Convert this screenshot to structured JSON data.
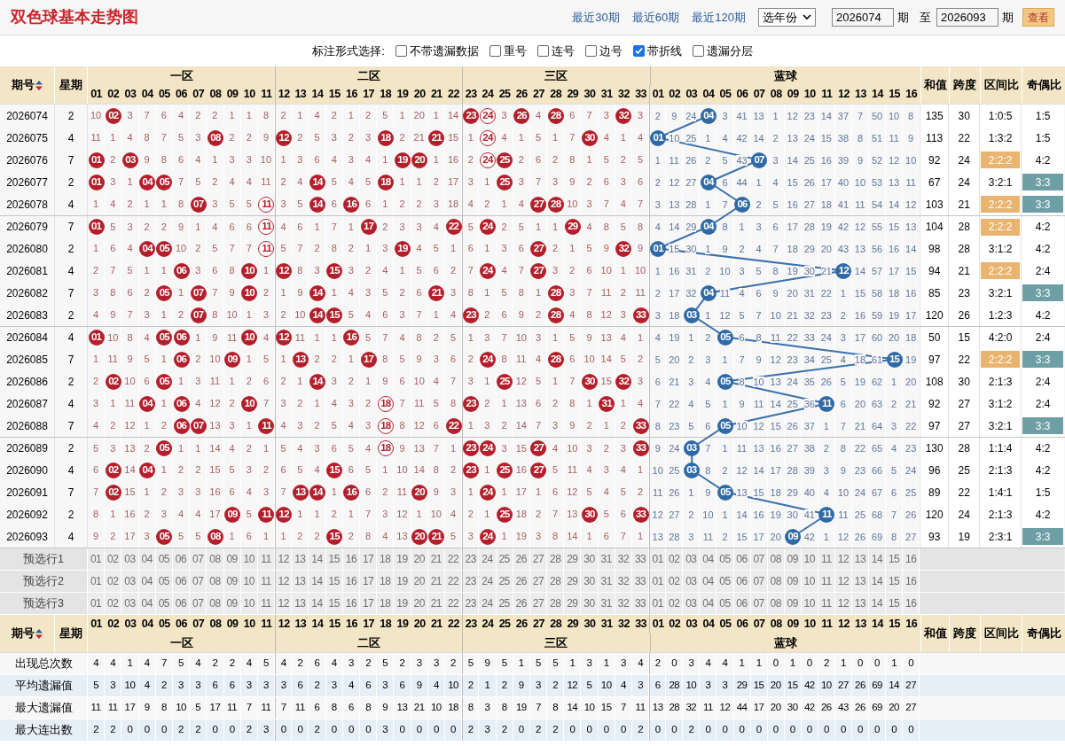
{
  "header": {
    "title": "双色球基本走势图",
    "links": [
      "最近30期",
      "最近60期",
      "最近120期"
    ],
    "year_select": "选年份",
    "from": "2026074",
    "from_unit": "期",
    "to_label": "至",
    "to": "2026093",
    "to_unit": "期",
    "button": "查看"
  },
  "options": {
    "label": "标注形式选择:",
    "items": [
      {
        "label": "不带遗漏数据",
        "checked": false
      },
      {
        "label": "重号",
        "checked": false
      },
      {
        "label": "连号",
        "checked": false
      },
      {
        "label": "边号",
        "checked": false
      },
      {
        "label": "带折线",
        "checked": true
      },
      {
        "label": "遗漏分层",
        "checked": false
      }
    ]
  },
  "top_header": {
    "period": "期号",
    "week": "星期",
    "zones": [
      "一区",
      "二区",
      "三区"
    ],
    "blue_label": "蓝球",
    "red": [
      "01",
      "02",
      "03",
      "04",
      "05",
      "06",
      "07",
      "08",
      "09",
      "10",
      "11",
      "12",
      "13",
      "14",
      "15",
      "16",
      "17",
      "18",
      "19",
      "20",
      "21",
      "22",
      "23",
      "24",
      "25",
      "26",
      "27",
      "28",
      "29",
      "30",
      "31",
      "32",
      "33"
    ],
    "blue": [
      "01",
      "02",
      "03",
      "04",
      "05",
      "06",
      "07",
      "08",
      "09",
      "10",
      "11",
      "12",
      "13",
      "14",
      "15",
      "16"
    ],
    "extra": [
      "和值",
      "跨度",
      "区间比",
      "奇偶比"
    ]
  },
  "rows": [
    {
      "period": "2026074",
      "week": "2",
      "red": [
        "10",
        {
          "v": "02",
          "kind": "hit"
        },
        "3",
        "7",
        "6",
        "4",
        "2",
        "2",
        "1",
        "1",
        "8",
        "2",
        "1",
        "4",
        "2",
        "1",
        "2",
        "5",
        "1",
        "20",
        "1",
        "14",
        {
          "v": "23",
          "kind": "hit"
        },
        {
          "v": "24",
          "kind": "ring"
        },
        "3",
        {
          "v": "26",
          "kind": "hit"
        },
        "4",
        {
          "v": "28",
          "kind": "hit"
        },
        "6",
        "7",
        "3",
        {
          "v": "32",
          "kind": "hit"
        },
        "3"
      ],
      "blue": [
        "2",
        "9",
        "24",
        {
          "v": "04",
          "kind": "hit"
        },
        "3",
        "41",
        "13",
        "1",
        "12",
        "23",
        "14",
        "37",
        "7",
        "50",
        "10",
        "8"
      ],
      "sum": "135",
      "span": "30",
      "zone_ratio": "1:0:5",
      "zone_ratio_marked": false,
      "odd_even": "1:5",
      "odd_even_marked": false
    },
    {
      "period": "2026075",
      "week": "4",
      "red": [
        "11",
        "1",
        "4",
        "8",
        "7",
        "5",
        "3",
        {
          "v": "08",
          "kind": "hit"
        },
        "2",
        "2",
        "9",
        {
          "v": "12",
          "kind": "hit"
        },
        "2",
        "5",
        "3",
        "2",
        "3",
        {
          "v": "18",
          "kind": "hit"
        },
        "2",
        "21",
        {
          "v": "21",
          "kind": "hit"
        },
        "15",
        "1",
        {
          "v": "24",
          "kind": "ring"
        },
        "4",
        "1",
        "5",
        "1",
        "7",
        {
          "v": "30",
          "kind": "hit"
        },
        "4",
        "1",
        "4"
      ],
      "blue": [
        {
          "v": "01",
          "kind": "hit"
        },
        "10",
        "25",
        "1",
        "4",
        "42",
        "14",
        "2",
        "13",
        "24",
        "15",
        "38",
        "8",
        "51",
        "11",
        "9"
      ],
      "sum": "113",
      "span": "22",
      "zone_ratio": "1:3:2",
      "zone_ratio_marked": false,
      "odd_even": "1:5",
      "odd_even_marked": false
    },
    {
      "period": "2026076",
      "week": "7",
      "red": [
        {
          "v": "01",
          "kind": "hit"
        },
        "2",
        {
          "v": "03",
          "kind": "hit"
        },
        "9",
        "8",
        "6",
        "4",
        "1",
        "3",
        "3",
        "10",
        "1",
        "3",
        "6",
        "4",
        "3",
        "4",
        "1",
        {
          "v": "19",
          "kind": "hit"
        },
        {
          "v": "20",
          "kind": "hit"
        },
        "1",
        "16",
        "2",
        {
          "v": "24",
          "kind": "ring"
        },
        {
          "v": "25",
          "kind": "hit"
        },
        "2",
        "6",
        "2",
        "8",
        "1",
        "5",
        "2",
        "5"
      ],
      "blue": [
        "1",
        "11",
        "26",
        "2",
        "5",
        "43",
        {
          "v": "07",
          "kind": "hit"
        },
        "3",
        "14",
        "25",
        "16",
        "39",
        "9",
        "52",
        "12",
        "10"
      ],
      "sum": "92",
      "span": "24",
      "zone_ratio": "2:2:2",
      "zone_ratio_marked": true,
      "odd_even": "4:2",
      "odd_even_marked": false
    },
    {
      "period": "2026077",
      "week": "2",
      "red": [
        {
          "v": "01",
          "kind": "hit"
        },
        "3",
        "1",
        {
          "v": "04",
          "kind": "hit"
        },
        {
          "v": "05",
          "kind": "hit"
        },
        "7",
        "5",
        "2",
        "4",
        "4",
        "11",
        "2",
        "4",
        {
          "v": "14",
          "kind": "hit"
        },
        "5",
        "4",
        "5",
        {
          "v": "18",
          "kind": "hit"
        },
        "1",
        "1",
        "2",
        "17",
        "3",
        "1",
        {
          "v": "25",
          "kind": "hit"
        },
        "3",
        "7",
        "3",
        "9",
        "2",
        "6",
        "3",
        "6"
      ],
      "blue": [
        "2",
        "12",
        "27",
        {
          "v": "04",
          "kind": "hit"
        },
        "6",
        "44",
        "1",
        "4",
        "15",
        "26",
        "17",
        "40",
        "10",
        "53",
        "13",
        "11"
      ],
      "sum": "67",
      "span": "24",
      "zone_ratio": "3:2:1",
      "zone_ratio_marked": false,
      "odd_even": "3:3",
      "odd_even_marked": true
    },
    {
      "period": "2026078",
      "week": "4",
      "red": [
        "1",
        "4",
        "2",
        "1",
        "1",
        "8",
        {
          "v": "07",
          "kind": "hit"
        },
        "3",
        "5",
        "5",
        {
          "v": "11",
          "kind": "ring"
        },
        "3",
        "5",
        {
          "v": "14",
          "kind": "hit"
        },
        "6",
        {
          "v": "16",
          "kind": "hit"
        },
        "6",
        "1",
        "2",
        "2",
        "3",
        "18",
        "4",
        "2",
        "1",
        "4",
        {
          "v": "27",
          "kind": "hit"
        },
        {
          "v": "28",
          "kind": "hit"
        },
        "10",
        "3",
        "7",
        "4",
        "7"
      ],
      "blue": [
        "3",
        "13",
        "28",
        "1",
        "7",
        {
          "v": "06",
          "kind": "hit"
        },
        "2",
        "5",
        "16",
        "27",
        "18",
        "41",
        "11",
        "54",
        "14",
        "12"
      ],
      "sum": "103",
      "span": "21",
      "zone_ratio": "2:2:2",
      "zone_ratio_marked": true,
      "odd_even": "3:3",
      "odd_even_marked": true
    },
    {
      "period": "2026079",
      "week": "7",
      "red": [
        {
          "v": "01",
          "kind": "hit"
        },
        "5",
        "3",
        "2",
        "2",
        "9",
        "1",
        "4",
        "6",
        "6",
        {
          "v": "11",
          "kind": "ring"
        },
        "4",
        "6",
        "1",
        "7",
        "1",
        {
          "v": "17",
          "kind": "hit"
        },
        "2",
        "3",
        "3",
        "4",
        {
          "v": "22",
          "kind": "hit"
        },
        "5",
        {
          "v": "24",
          "kind": "hit"
        },
        "2",
        "5",
        "1",
        "1",
        {
          "v": "29",
          "kind": "hit"
        },
        "4",
        "8",
        "5",
        "8"
      ],
      "blue": [
        "4",
        "14",
        "29",
        {
          "v": "04",
          "kind": "hit"
        },
        "8",
        "1",
        "3",
        "6",
        "17",
        "28",
        "19",
        "42",
        "12",
        "55",
        "15",
        "13"
      ],
      "sum": "104",
      "span": "28",
      "zone_ratio": "2:2:2",
      "zone_ratio_marked": true,
      "odd_even": "4:2",
      "odd_even_marked": false
    },
    {
      "period": "2026080",
      "week": "2",
      "red": [
        "1",
        "6",
        "4",
        {
          "v": "04",
          "kind": "hit"
        },
        {
          "v": "05",
          "kind": "hit"
        },
        "10",
        "2",
        "5",
        "7",
        "7",
        {
          "v": "11",
          "kind": "ring"
        },
        "5",
        "7",
        "2",
        "8",
        "2",
        "1",
        "3",
        {
          "v": "19",
          "kind": "hit"
        },
        "4",
        "5",
        "1",
        "6",
        "1",
        "3",
        "6",
        {
          "v": "27",
          "kind": "hit"
        },
        "2",
        "1",
        "5",
        "9",
        {
          "v": "32",
          "kind": "hit"
        },
        "9"
      ],
      "blue": [
        {
          "v": "01",
          "kind": "hit"
        },
        "15",
        "30",
        "1",
        "9",
        "2",
        "4",
        "7",
        "18",
        "29",
        "20",
        "43",
        "13",
        "56",
        "16",
        "14"
      ],
      "sum": "98",
      "span": "28",
      "zone_ratio": "3:1:2",
      "zone_ratio_marked": false,
      "odd_even": "4:2",
      "odd_even_marked": false
    },
    {
      "period": "2026081",
      "week": "4",
      "red": [
        "2",
        "7",
        "5",
        "1",
        "1",
        {
          "v": "06",
          "kind": "hit"
        },
        "3",
        "6",
        "8",
        {
          "v": "10",
          "kind": "hit"
        },
        "1",
        {
          "v": "12",
          "kind": "hit"
        },
        "8",
        "3",
        {
          "v": "15",
          "kind": "hit"
        },
        "3",
        "2",
        "4",
        "1",
        "5",
        "6",
        "2",
        "7",
        {
          "v": "24",
          "kind": "hit"
        },
        "4",
        "7",
        {
          "v": "27",
          "kind": "hit"
        },
        "3",
        "2",
        "6",
        "10",
        "1",
        "10"
      ],
      "blue": [
        "1",
        "16",
        "31",
        "2",
        "10",
        "3",
        "5",
        "8",
        "19",
        "30",
        "21",
        {
          "v": "12",
          "kind": "hit"
        },
        "14",
        "57",
        "17",
        "15"
      ],
      "sum": "94",
      "span": "21",
      "zone_ratio": "2:2:2",
      "zone_ratio_marked": true,
      "odd_even": "2:4",
      "odd_even_marked": false
    },
    {
      "period": "2026082",
      "week": "7",
      "red": [
        "3",
        "8",
        "6",
        "2",
        {
          "v": "05",
          "kind": "hit"
        },
        "1",
        {
          "v": "07",
          "kind": "hit"
        },
        "7",
        "9",
        {
          "v": "10",
          "kind": "hit"
        },
        "2",
        "1",
        "9",
        {
          "v": "14",
          "kind": "hit"
        },
        "1",
        "4",
        "3",
        "5",
        "2",
        "6",
        {
          "v": "21",
          "kind": "hit"
        },
        "3",
        "8",
        "1",
        "5",
        "8",
        "1",
        {
          "v": "28",
          "kind": "hit"
        },
        "3",
        "7",
        "11",
        "2",
        "11"
      ],
      "blue": [
        "2",
        "17",
        "32",
        {
          "v": "04",
          "kind": "hit"
        },
        "11",
        "4",
        "6",
        "9",
        "20",
        "31",
        "22",
        "1",
        "15",
        "58",
        "18",
        "16"
      ],
      "sum": "85",
      "span": "23",
      "zone_ratio": "3:2:1",
      "zone_ratio_marked": false,
      "odd_even": "3:3",
      "odd_even_marked": true
    },
    {
      "period": "2026083",
      "week": "2",
      "red": [
        "4",
        "9",
        "7",
        "3",
        "1",
        "2",
        {
          "v": "07",
          "kind": "hit"
        },
        "8",
        "10",
        "1",
        "3",
        "2",
        "10",
        {
          "v": "14",
          "kind": "hit"
        },
        {
          "v": "15",
          "kind": "hit"
        },
        "5",
        "4",
        "6",
        "3",
        "7",
        "1",
        "4",
        {
          "v": "23",
          "kind": "hit"
        },
        "2",
        "6",
        "9",
        "2",
        {
          "v": "28",
          "kind": "hit"
        },
        "4",
        "8",
        "12",
        "3",
        {
          "v": "33",
          "kind": "hit"
        }
      ],
      "blue": [
        "3",
        "18",
        {
          "v": "03",
          "kind": "hit"
        },
        "1",
        "12",
        "5",
        "7",
        "10",
        "21",
        "32",
        "23",
        "2",
        "16",
        "59",
        "19",
        "17"
      ],
      "sum": "120",
      "span": "26",
      "zone_ratio": "1:2:3",
      "zone_ratio_marked": false,
      "odd_even": "4:2",
      "odd_even_marked": false
    },
    {
      "period": "2026084",
      "week": "4",
      "red": [
        {
          "v": "01",
          "kind": "hit"
        },
        "10",
        "8",
        "4",
        {
          "v": "05",
          "kind": "hit"
        },
        {
          "v": "06",
          "kind": "hit"
        },
        "1",
        "9",
        "11",
        {
          "v": "10",
          "kind": "hit"
        },
        "4",
        {
          "v": "12",
          "kind": "hit"
        },
        "11",
        "1",
        "1",
        {
          "v": "16",
          "kind": "hit"
        },
        "5",
        "7",
        "4",
        "8",
        "2",
        "5",
        "1",
        "3",
        "7",
        "10",
        "3",
        "1",
        "5",
        "9",
        "13",
        "4",
        "1"
      ],
      "blue": [
        "4",
        "19",
        "1",
        "2",
        {
          "v": "05",
          "kind": "hit"
        },
        "6",
        "8",
        "11",
        "22",
        "33",
        "24",
        "3",
        "17",
        "60",
        "20",
        "18"
      ],
      "sum": "50",
      "span": "15",
      "zone_ratio": "4:2:0",
      "zone_ratio_marked": false,
      "odd_even": "2:4",
      "odd_even_marked": false
    },
    {
      "period": "2026085",
      "week": "7",
      "red": [
        "1",
        "11",
        "9",
        "5",
        "1",
        {
          "v": "06",
          "kind": "hit"
        },
        "2",
        "10",
        {
          "v": "09",
          "kind": "hit"
        },
        "1",
        "5",
        "1",
        {
          "v": "13",
          "kind": "hit"
        },
        "2",
        "2",
        "1",
        {
          "v": "17",
          "kind": "hit"
        },
        "8",
        "5",
        "9",
        "3",
        "6",
        "2",
        {
          "v": "24",
          "kind": "hit"
        },
        "8",
        "11",
        "4",
        {
          "v": "28",
          "kind": "hit"
        },
        "6",
        "10",
        "14",
        "5",
        "2"
      ],
      "blue": [
        "5",
        "20",
        "2",
        "3",
        "1",
        "7",
        "9",
        "12",
        "23",
        "34",
        "25",
        "4",
        "18",
        "61",
        {
          "v": "15",
          "kind": "hit"
        },
        "19"
      ],
      "sum": "97",
      "span": "22",
      "zone_ratio": "2:2:2",
      "zone_ratio_marked": true,
      "odd_even": "3:3",
      "odd_even_marked": true
    },
    {
      "period": "2026086",
      "week": "2",
      "red": [
        "2",
        {
          "v": "02",
          "kind": "hit"
        },
        "10",
        "6",
        {
          "v": "05",
          "kind": "hit"
        },
        "1",
        "3",
        "11",
        "1",
        "2",
        "6",
        "2",
        "1",
        {
          "v": "14",
          "kind": "hit"
        },
        "3",
        "2",
        "1",
        "9",
        "6",
        "10",
        "4",
        "7",
        "3",
        "1",
        {
          "v": "25",
          "kind": "hit"
        },
        "12",
        "5",
        "1",
        "7",
        {
          "v": "30",
          "kind": "hit"
        },
        "15",
        {
          "v": "32",
          "kind": "hit"
        },
        "3"
      ],
      "blue": [
        "6",
        "21",
        "3",
        "4",
        {
          "v": "05",
          "kind": "hit"
        },
        "8",
        "10",
        "13",
        "24",
        "35",
        "26",
        "5",
        "19",
        "62",
        "1",
        "20"
      ],
      "sum": "108",
      "span": "30",
      "zone_ratio": "2:1:3",
      "zone_ratio_marked": false,
      "odd_even": "2:4",
      "odd_even_marked": false
    },
    {
      "period": "2026087",
      "week": "4",
      "red": [
        "3",
        "1",
        "11",
        {
          "v": "04",
          "kind": "hit"
        },
        "1",
        {
          "v": "06",
          "kind": "hit"
        },
        "4",
        "12",
        "2",
        {
          "v": "10",
          "kind": "hit"
        },
        "7",
        "3",
        "2",
        "1",
        "4",
        "3",
        "2",
        {
          "v": "18",
          "kind": "ring"
        },
        "7",
        "11",
        "5",
        "8",
        {
          "v": "23",
          "kind": "hit"
        },
        "2",
        "1",
        "13",
        "6",
        "2",
        "8",
        "1",
        {
          "v": "31",
          "kind": "hit"
        },
        "1",
        "4"
      ],
      "blue": [
        "7",
        "22",
        "4",
        "5",
        "1",
        "9",
        "11",
        "14",
        "25",
        "36",
        {
          "v": "11",
          "kind": "hit"
        },
        "6",
        "20",
        "63",
        "2",
        "21"
      ],
      "sum": "92",
      "span": "27",
      "zone_ratio": "3:1:2",
      "zone_ratio_marked": false,
      "odd_even": "2:4",
      "odd_even_marked": false
    },
    {
      "period": "2026088",
      "week": "7",
      "red": [
        "4",
        "2",
        "12",
        "1",
        "2",
        {
          "v": "06",
          "kind": "hit"
        },
        {
          "v": "07",
          "kind": "hit"
        },
        "13",
        "3",
        "1",
        {
          "v": "11",
          "kind": "hit"
        },
        "4",
        "3",
        "2",
        "5",
        "4",
        "3",
        {
          "v": "18",
          "kind": "ring"
        },
        "8",
        "12",
        "6",
        {
          "v": "22",
          "kind": "hit"
        },
        "1",
        "3",
        "2",
        "14",
        "7",
        "3",
        "9",
        "2",
        "1",
        "2",
        {
          "v": "33",
          "kind": "hit"
        }
      ],
      "blue": [
        "8",
        "23",
        "5",
        "6",
        {
          "v": "05",
          "kind": "hit"
        },
        "10",
        "12",
        "15",
        "26",
        "37",
        "1",
        "7",
        "21",
        "64",
        "3",
        "22"
      ],
      "sum": "97",
      "span": "27",
      "zone_ratio": "3:2:1",
      "zone_ratio_marked": false,
      "odd_even": "3:3",
      "odd_even_marked": true
    },
    {
      "period": "2026089",
      "week": "2",
      "red": [
        "5",
        "3",
        "13",
        "2",
        {
          "v": "05",
          "kind": "hit"
        },
        "1",
        "1",
        "14",
        "4",
        "2",
        "1",
        "5",
        "4",
        "3",
        "6",
        "5",
        "4",
        {
          "v": "18",
          "kind": "ring"
        },
        "9",
        "13",
        "7",
        "1",
        {
          "v": "23",
          "kind": "hit"
        },
        {
          "v": "24",
          "kind": "hit"
        },
        "3",
        "15",
        {
          "v": "27",
          "kind": "hit"
        },
        "4",
        "10",
        "3",
        "2",
        "3",
        {
          "v": "33",
          "kind": "hit"
        }
      ],
      "blue": [
        "9",
        "24",
        {
          "v": "03",
          "kind": "hit"
        },
        "7",
        "1",
        "11",
        "13",
        "16",
        "27",
        "38",
        "2",
        "8",
        "22",
        "65",
        "4",
        "23"
      ],
      "sum": "130",
      "span": "28",
      "zone_ratio": "1:1:4",
      "zone_ratio_marked": false,
      "odd_even": "4:2",
      "odd_even_marked": false
    },
    {
      "period": "2026090",
      "week": "4",
      "red": [
        "6",
        {
          "v": "02",
          "kind": "hit"
        },
        "14",
        {
          "v": "04",
          "kind": "hit"
        },
        "1",
        "2",
        "2",
        "15",
        "5",
        "3",
        "2",
        "6",
        "5",
        "4",
        {
          "v": "15",
          "kind": "hit"
        },
        "6",
        "5",
        "1",
        "10",
        "14",
        "8",
        "2",
        {
          "v": "23",
          "kind": "hit"
        },
        "1",
        {
          "v": "25",
          "kind": "hit"
        },
        "16",
        {
          "v": "27",
          "kind": "hit"
        },
        "5",
        "11",
        "4",
        "3",
        "4",
        "1"
      ],
      "blue": [
        "10",
        "25",
        {
          "v": "03",
          "kind": "hit"
        },
        "8",
        "2",
        "12",
        "14",
        "17",
        "28",
        "39",
        "3",
        "9",
        "23",
        "66",
        "5",
        "24"
      ],
      "sum": "96",
      "span": "25",
      "zone_ratio": "2:1:3",
      "zone_ratio_marked": false,
      "odd_even": "4:2",
      "odd_even_marked": false
    },
    {
      "period": "2026091",
      "week": "7",
      "red": [
        "7",
        {
          "v": "02",
          "kind": "hit"
        },
        "15",
        "1",
        "2",
        "3",
        "3",
        "16",
        "6",
        "4",
        "3",
        "7",
        {
          "v": "13",
          "kind": "hit"
        },
        {
          "v": "14",
          "kind": "hit"
        },
        "1",
        {
          "v": "16",
          "kind": "hit"
        },
        "6",
        "2",
        "11",
        {
          "v": "20",
          "kind": "hit"
        },
        "9",
        "3",
        "1",
        {
          "v": "24",
          "kind": "hit"
        },
        "1",
        "17",
        "1",
        "6",
        "12",
        "5",
        "4",
        "5",
        "2"
      ],
      "blue": [
        "11",
        "26",
        "1",
        "9",
        {
          "v": "05",
          "kind": "hit"
        },
        "13",
        "15",
        "18",
        "29",
        "40",
        "4",
        "10",
        "24",
        "67",
        "6",
        "25"
      ],
      "sum": "89",
      "span": "22",
      "zone_ratio": "1:4:1",
      "zone_ratio_marked": false,
      "odd_even": "1:5",
      "odd_even_marked": false
    },
    {
      "period": "2026092",
      "week": "2",
      "red": [
        "8",
        "1",
        "16",
        "2",
        "3",
        "4",
        "4",
        "17",
        {
          "v": "09",
          "kind": "hit"
        },
        "5",
        {
          "v": "11",
          "kind": "hit"
        },
        {
          "v": "12",
          "kind": "hit"
        },
        "1",
        "1",
        "2",
        "1",
        "7",
        "3",
        "12",
        "1",
        "10",
        "4",
        "2",
        "1",
        {
          "v": "25",
          "kind": "hit"
        },
        "18",
        "2",
        "7",
        "13",
        {
          "v": "30",
          "kind": "hit"
        },
        "5",
        "6",
        {
          "v": "33",
          "kind": "hit"
        }
      ],
      "blue": [
        "12",
        "27",
        "2",
        "10",
        "1",
        "14",
        "16",
        "19",
        "30",
        "41",
        {
          "v": "11",
          "kind": "hit"
        },
        "11",
        "25",
        "68",
        "7",
        "26"
      ],
      "sum": "120",
      "span": "24",
      "zone_ratio": "2:1:3",
      "zone_ratio_marked": false,
      "odd_even": "4:2",
      "odd_even_marked": false
    },
    {
      "period": "2026093",
      "week": "4",
      "red": [
        "9",
        "2",
        "17",
        "3",
        {
          "v": "05",
          "kind": "hit"
        },
        "5",
        "5",
        {
          "v": "08",
          "kind": "hit"
        },
        "1",
        "6",
        "1",
        "1",
        "2",
        "2",
        {
          "v": "15",
          "kind": "hit"
        },
        "2",
        "8",
        "4",
        "13",
        {
          "v": "20",
          "kind": "hit"
        },
        {
          "v": "21",
          "kind": "hit"
        },
        "5",
        "3",
        {
          "v": "24",
          "kind": "hit"
        },
        "1",
        "19",
        "3",
        "8",
        "14",
        "1",
        "6",
        "7",
        "1"
      ],
      "blue": [
        "13",
        "28",
        "3",
        "11",
        "2",
        "15",
        "17",
        "20",
        {
          "v": "09",
          "kind": "hit"
        },
        "42",
        "1",
        "12",
        "26",
        "69",
        "8",
        "27"
      ],
      "sum": "93",
      "span": "19",
      "zone_ratio": "2:3:1",
      "zone_ratio_marked": false,
      "odd_even": "3:3",
      "odd_even_marked": true
    }
  ],
  "preselect": [
    {
      "label": "预选行1",
      "red": [
        "01",
        "02",
        "03",
        "04",
        "05",
        "06",
        "07",
        "08",
        "09",
        "10",
        "11",
        "12",
        "13",
        "14",
        "15",
        "16",
        "17",
        "18",
        "19",
        "20",
        "21",
        "22",
        "23",
        "24",
        "25",
        "26",
        "27",
        "28",
        "29",
        "30",
        "31",
        "32",
        "33"
      ],
      "blue": [
        "01",
        "02",
        "03",
        "04",
        "05",
        "06",
        "07",
        "08",
        "09",
        "10",
        "11",
        "12",
        "13",
        "14",
        "15",
        "16"
      ]
    },
    {
      "label": "预选行2",
      "red": [
        "01",
        "02",
        "03",
        "04",
        "05",
        "06",
        "07",
        "08",
        "09",
        "10",
        "11",
        "12",
        "13",
        "14",
        "15",
        "16",
        "17",
        "18",
        "19",
        "20",
        "21",
        "22",
        "23",
        "24",
        "25",
        "26",
        "27",
        "28",
        "29",
        "30",
        "31",
        "32",
        "33"
      ],
      "blue": [
        "01",
        "02",
        "03",
        "04",
        "05",
        "06",
        "07",
        "08",
        "09",
        "10",
        "11",
        "12",
        "13",
        "14",
        "15",
        "16"
      ]
    },
    {
      "label": "预选行3",
      "red": [
        "01",
        "02",
        "03",
        "04",
        "05",
        "06",
        "07",
        "08",
        "09",
        "10",
        "11",
        "12",
        "13",
        "14",
        "15",
        "16",
        "17",
        "18",
        "19",
        "20",
        "21",
        "22",
        "23",
        "24",
        "25",
        "26",
        "27",
        "28",
        "29",
        "30",
        "31",
        "32",
        "33"
      ],
      "blue": [
        "01",
        "02",
        "03",
        "04",
        "05",
        "06",
        "07",
        "08",
        "09",
        "10",
        "11",
        "12",
        "13",
        "14",
        "15",
        "16"
      ]
    }
  ],
  "bottom_header": {
    "period": "期号",
    "week": "星期",
    "zones": [
      "一区",
      "二区",
      "三区"
    ],
    "blue_label": "蓝球",
    "red": [
      "01",
      "02",
      "03",
      "04",
      "05",
      "06",
      "07",
      "08",
      "09",
      "10",
      "11",
      "12",
      "13",
      "14",
      "15",
      "16",
      "17",
      "18",
      "19",
      "20",
      "21",
      "22",
      "23",
      "24",
      "25",
      "26",
      "27",
      "28",
      "29",
      "30",
      "31",
      "32",
      "33"
    ],
    "blue": [
      "01",
      "02",
      "03",
      "04",
      "05",
      "06",
      "07",
      "08",
      "09",
      "10",
      "11",
      "12",
      "13",
      "14",
      "15",
      "16"
    ],
    "extra": [
      "和值",
      "跨度",
      "区间比",
      "奇偶比"
    ]
  },
  "stats": [
    {
      "label": "出现总次数",
      "red": [
        "4",
        "4",
        "1",
        "4",
        "7",
        "5",
        "4",
        "2",
        "2",
        "4",
        "5",
        "4",
        "2",
        "6",
        "4",
        "3",
        "2",
        "5",
        "2",
        "3",
        "3",
        "2",
        "5",
        "9",
        "5",
        "1",
        "5",
        "5",
        "1",
        "3",
        "1",
        "3",
        "4"
      ],
      "blue": [
        "2",
        "0",
        "3",
        "4",
        "4",
        "1",
        "1",
        "0",
        "1",
        "0",
        "2",
        "1",
        "0",
        "0",
        "1",
        "0"
      ]
    },
    {
      "label": "平均遗漏值",
      "red": [
        "5",
        "3",
        "10",
        "4",
        "2",
        "3",
        "3",
        "6",
        "6",
        "3",
        "3",
        "3",
        "6",
        "2",
        "3",
        "4",
        "6",
        "3",
        "6",
        "9",
        "4",
        "10",
        "2",
        "1",
        "2",
        "9",
        "3",
        "2",
        "12",
        "5",
        "10",
        "4",
        "3"
      ],
      "blue": [
        "6",
        "28",
        "10",
        "3",
        "3",
        "29",
        "15",
        "20",
        "15",
        "42",
        "10",
        "27",
        "26",
        "69",
        "14",
        "27"
      ]
    },
    {
      "label": "最大遗漏值",
      "red": [
        "11",
        "11",
        "17",
        "9",
        "8",
        "10",
        "5",
        "17",
        "11",
        "7",
        "11",
        "7",
        "11",
        "6",
        "8",
        "6",
        "8",
        "9",
        "13",
        "21",
        "10",
        "18",
        "8",
        "3",
        "8",
        "19",
        "7",
        "8",
        "14",
        "10",
        "15",
        "7",
        "11"
      ],
      "blue": [
        "13",
        "28",
        "32",
        "11",
        "12",
        "44",
        "17",
        "20",
        "30",
        "42",
        "26",
        "43",
        "26",
        "69",
        "20",
        "27"
      ]
    },
    {
      "label": "最大连出数",
      "red": [
        "2",
        "2",
        "0",
        "0",
        "0",
        "2",
        "2",
        "0",
        "0",
        "2",
        "3",
        "0",
        "0",
        "2",
        "0",
        "0",
        "0",
        "3",
        "0",
        "0",
        "0",
        "0",
        "2",
        "3",
        "2",
        "0",
        "2",
        "2",
        "0",
        "0",
        "0",
        "0",
        "2"
      ],
      "blue": [
        "0",
        "0",
        "2",
        "0",
        "0",
        "0",
        "0",
        "0",
        "0",
        "0",
        "0",
        "0",
        "0",
        "0",
        "0",
        "0"
      ]
    }
  ]
}
